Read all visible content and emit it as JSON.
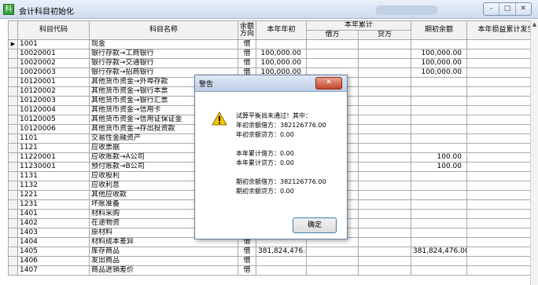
{
  "window": {
    "title": "会计科目初始化",
    "app_icon": "科",
    "controls": [
      "–",
      "□",
      "✕"
    ]
  },
  "table": {
    "headers": {
      "code": "科目代码",
      "name": "科目名称",
      "balance_dir": "余额方向",
      "opening": "本年年初",
      "accum_group": "本年累计",
      "debit": "借方",
      "credit": "贷方",
      "initial_balance": "期初余额",
      "pl_accum": "本年损益累计发生"
    },
    "rows": [
      {
        "code": "1001",
        "name": "现金",
        "dir": "借",
        "opening": "",
        "debit": "",
        "credit": "",
        "initial": ""
      },
      {
        "code": "10020001",
        "name": "银行存款→工商银行",
        "dir": "借",
        "opening": "100,000.00",
        "debit": "",
        "credit": "",
        "initial": "100,000.00"
      },
      {
        "code": "10020002",
        "name": "银行存款→交通银行",
        "dir": "借",
        "opening": "100,000.00",
        "debit": "",
        "credit": "",
        "initial": "100,000.00"
      },
      {
        "code": "10020003",
        "name": "银行存款→招商银行",
        "dir": "借",
        "opening": "100,000.00",
        "debit": "",
        "credit": "",
        "initial": "100,000.00"
      },
      {
        "code": "10120001",
        "name": "其他货币资金→外埠存款",
        "dir": "借",
        "opening": "",
        "debit": "",
        "credit": "",
        "initial": ""
      },
      {
        "code": "10120002",
        "name": "其他货币资金→银行本票",
        "dir": "借",
        "opening": "",
        "debit": "",
        "credit": "",
        "initial": ""
      },
      {
        "code": "10120003",
        "name": "其他货币资金→银行汇票",
        "dir": "借",
        "opening": "",
        "debit": "",
        "credit": "",
        "initial": ""
      },
      {
        "code": "10120004",
        "name": "其他货币资金→信用卡",
        "dir": "借",
        "opening": "",
        "debit": "",
        "credit": "",
        "initial": ""
      },
      {
        "code": "10120005",
        "name": "其他货币资金→信用证保证金",
        "dir": "借",
        "opening": "",
        "debit": "",
        "credit": "",
        "initial": ""
      },
      {
        "code": "10120006",
        "name": "其他货币资金→存出投资款",
        "dir": "借",
        "opening": "",
        "debit": "",
        "credit": "",
        "initial": ""
      },
      {
        "code": "1101",
        "name": "交易性金融资产",
        "dir": "借",
        "opening": "",
        "debit": "",
        "credit": "",
        "initial": ""
      },
      {
        "code": "1121",
        "name": "应收票据",
        "dir": "借",
        "opening": "",
        "debit": "",
        "credit": "",
        "initial": ""
      },
      {
        "code": "11220001",
        "name": "应收账款→A公司",
        "dir": "借",
        "opening": "",
        "debit": "",
        "credit": "",
        "initial": "100.00"
      },
      {
        "code": "11230001",
        "name": "预付账款→B公司",
        "dir": "借",
        "opening": "",
        "debit": "",
        "credit": "",
        "initial": "100.00"
      },
      {
        "code": "1131",
        "name": "应收股利",
        "dir": "借",
        "opening": "",
        "debit": "",
        "credit": "",
        "initial": ""
      },
      {
        "code": "1132",
        "name": "应收利息",
        "dir": "借",
        "opening": "",
        "debit": "",
        "credit": "",
        "initial": ""
      },
      {
        "code": "1221",
        "name": "其他应收款",
        "dir": "借",
        "opening": "",
        "debit": "",
        "credit": "",
        "initial": ""
      },
      {
        "code": "1231",
        "name": "坏账准备",
        "dir": "贷",
        "opening": "",
        "debit": "",
        "credit": "",
        "initial": ""
      },
      {
        "code": "1401",
        "name": "材料采购",
        "dir": "借",
        "opening": "",
        "debit": "",
        "credit": "",
        "initial": ""
      },
      {
        "code": "1402",
        "name": "在途物资",
        "dir": "借",
        "opening": "",
        "debit": "",
        "credit": "",
        "initial": ""
      },
      {
        "code": "1403",
        "name": "原材料",
        "dir": "借",
        "opening": "",
        "debit": "",
        "credit": "",
        "initial": ""
      },
      {
        "code": "1404",
        "name": "材料成本差异",
        "dir": "借",
        "opening": "",
        "debit": "",
        "credit": "",
        "initial": ""
      },
      {
        "code": "1405",
        "name": "库存商品",
        "dir": "借",
        "opening": "381,824,476.00",
        "debit": "",
        "credit": "",
        "initial": "381,824,476.00"
      },
      {
        "code": "1406",
        "name": "发出商品",
        "dir": "借",
        "opening": "",
        "debit": "",
        "credit": "",
        "initial": ""
      },
      {
        "code": "1407",
        "name": "商品进销差价",
        "dir": "借",
        "opening": "",
        "debit": "",
        "credit": "",
        "initial": ""
      }
    ]
  },
  "dialog": {
    "title": "警告",
    "close_label": "✕",
    "icon": "warning-triangle-icon",
    "lines": [
      "试算平衡尚未通过！其中：",
      "年初余额借方：382126776.00",
      "年初余额贷方：0.00",
      "",
      "本年累计借方：0.00",
      "本年累计贷方：0.00",
      "",
      "期初余额借方：382126776.00",
      "期初余额贷方：0.00"
    ],
    "ok_label": "确定"
  }
}
